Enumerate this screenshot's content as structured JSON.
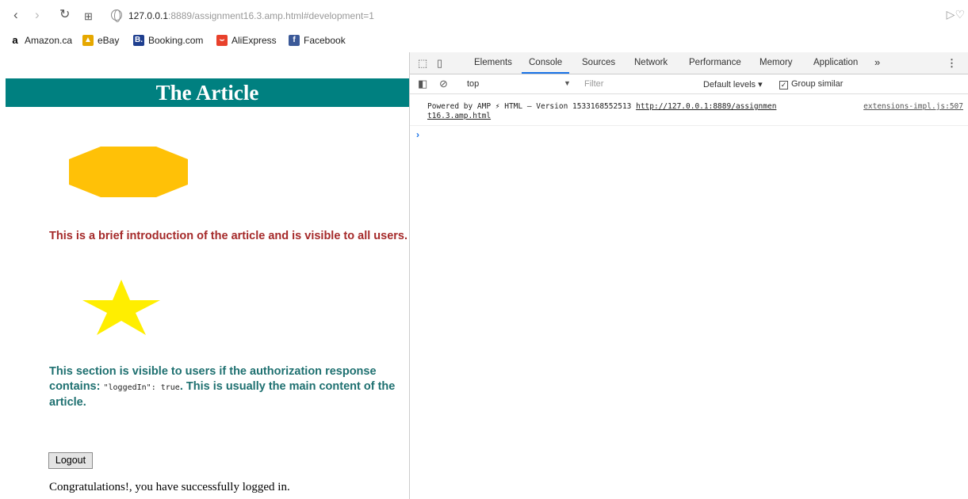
{
  "browser": {
    "url_host": "127.0.0.1",
    "url_rest": ":8889/assignment16.3.amp.html#development=1",
    "back_icon": "chevron-left-icon",
    "forward_icon": "chevron-right-icon",
    "reload_icon": "reload-icon",
    "apps_icon": "apps-grid-icon"
  },
  "bookmarks": [
    {
      "label": "Amazon.ca",
      "icon": "a",
      "color": "#000000"
    },
    {
      "label": "eBay",
      "icon": "e",
      "color": "#e6a800"
    },
    {
      "label": "Booking.com",
      "icon": "B",
      "color": "#1f3f8f"
    },
    {
      "label": "AliExpress",
      "icon": "A",
      "color": "#e8412c"
    },
    {
      "label": "Facebook",
      "icon": "f",
      "color": "#3b5998"
    }
  ],
  "page": {
    "title": "The Article",
    "intro": "This is a brief introduction of the article and is visible to all users.",
    "section_part1": "This section is visible to users if the authorization response contains: ",
    "section_code": "\"loggedIn\": true",
    "section_part2": ". This is usually the main content of the article.",
    "logout_label": "Logout",
    "congrats": "Congratulations!, you have successfully logged in.",
    "header_color": "#008080",
    "intro_color": "#a52a2a",
    "section_color": "#1e7070",
    "hexagon_color": "#ffc107",
    "star_color": "#ffee00"
  },
  "devtools": {
    "tabs": [
      "Elements",
      "Console",
      "Sources",
      "Network",
      "Performance",
      "Memory",
      "Application"
    ],
    "active_tab": "Console",
    "more_label": "»",
    "context": "top",
    "filter_placeholder": "Filter",
    "levels_label": "Default levels ▾",
    "group_similar_label": "Group similar",
    "message_prefix": "Powered by AMP ⚡ HTML – Version 1533168552513 ",
    "message_link": "http://127.0.0.1:8889/assignment16.3.amp.html",
    "message_link_part1": "http://127.0.0.1:8889/assignmen",
    "message_link_part2": "t16.3.amp.html",
    "message_source": "extensions-impl.js:507",
    "prompt": "›"
  }
}
